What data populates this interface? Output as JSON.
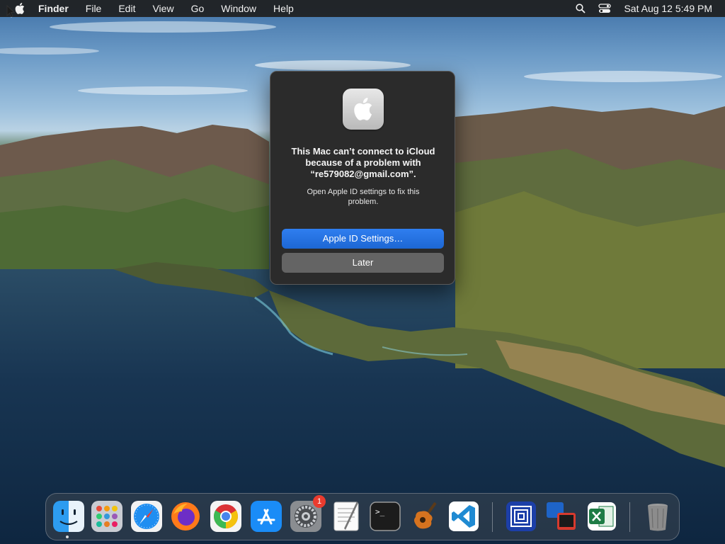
{
  "menubar": {
    "app_name": "Finder",
    "items": [
      "File",
      "Edit",
      "View",
      "Go",
      "Window",
      "Help"
    ],
    "clock": "Sat Aug 12  5:49 PM",
    "icons": [
      "apple-logo-icon",
      "search-icon",
      "control-center-icon"
    ]
  },
  "dialog": {
    "title": "This Mac can’t connect to iCloud because of a problem with “re579082@gmail.com”.",
    "message": "Open Apple ID settings to fix this problem.",
    "primary_button": "Apple ID Settings…",
    "secondary_button": "Later",
    "icon": "apple-id-icon",
    "accent_color": "#1d6fe0"
  },
  "dock": {
    "apps": [
      {
        "name": "Finder",
        "icon": "finder-icon",
        "running": true
      },
      {
        "name": "Launchpad",
        "icon": "launchpad-icon"
      },
      {
        "name": "Safari",
        "icon": "safari-icon"
      },
      {
        "name": "Firefox",
        "icon": "firefox-icon"
      },
      {
        "name": "Google Chrome",
        "icon": "chrome-icon"
      },
      {
        "name": "App Store",
        "icon": "app-store-icon"
      },
      {
        "name": "System Preferences",
        "icon": "system-preferences-icon",
        "badge": "1"
      },
      {
        "name": "TextEdit",
        "icon": "textedit-icon"
      },
      {
        "name": "Terminal",
        "icon": "terminal-icon"
      },
      {
        "name": "GarageBand",
        "icon": "garageband-icon"
      },
      {
        "name": "Visual Studio Code",
        "icon": "vscode-icon"
      },
      {
        "name": "Screen app",
        "icon": "screen-app-icon"
      },
      {
        "name": "Remote desktop",
        "icon": "remote-desktop-icon"
      },
      {
        "name": "Microsoft Excel",
        "icon": "excel-icon"
      },
      {
        "name": "Trash",
        "icon": "trash-icon"
      }
    ],
    "terminal_prompt": ">_"
  }
}
